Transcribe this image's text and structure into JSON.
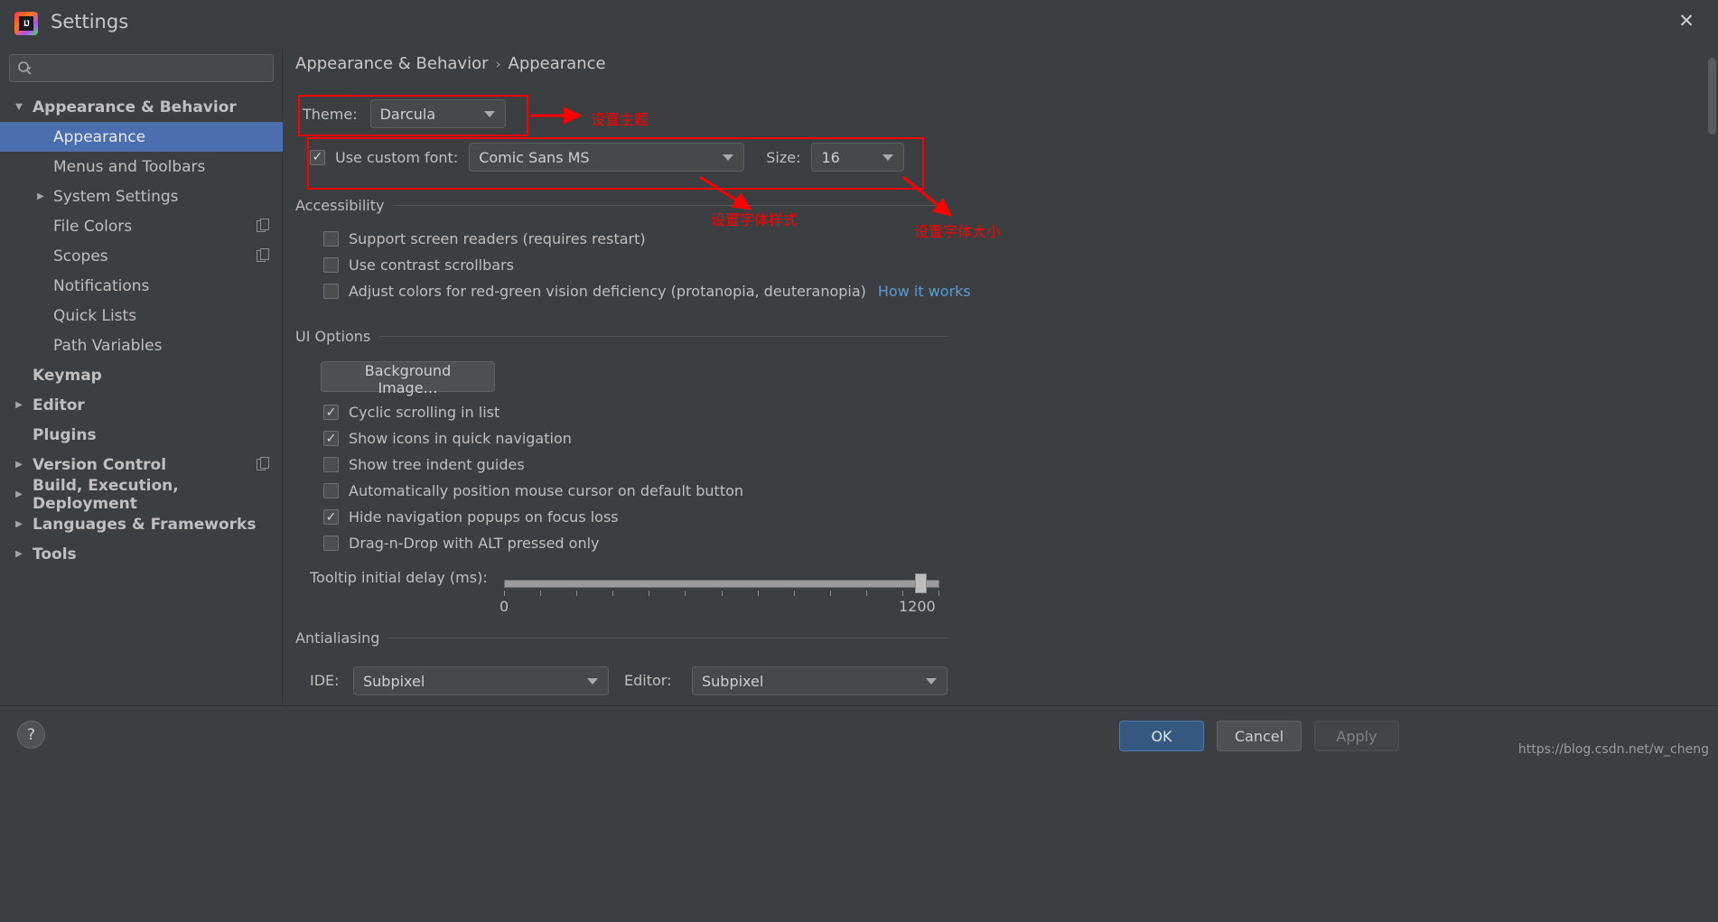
{
  "window": {
    "title": "Settings",
    "logo_text": "IJ",
    "close_icon": "✕"
  },
  "search": {
    "value": "",
    "placeholder": ""
  },
  "sidebar": {
    "items": [
      {
        "label": "Appearance & Behavior",
        "level": 0,
        "twisty": "down",
        "selected": false,
        "badge": false
      },
      {
        "label": "Appearance",
        "level": 1,
        "twisty": "none",
        "selected": true,
        "badge": false
      },
      {
        "label": "Menus and Toolbars",
        "level": 1,
        "twisty": "none",
        "selected": false,
        "badge": false
      },
      {
        "label": "System Settings",
        "level": 1,
        "twisty": "right",
        "selected": false,
        "badge": false
      },
      {
        "label": "File Colors",
        "level": 1,
        "twisty": "none",
        "selected": false,
        "badge": true
      },
      {
        "label": "Scopes",
        "level": 1,
        "twisty": "none",
        "selected": false,
        "badge": true
      },
      {
        "label": "Notifications",
        "level": 1,
        "twisty": "none",
        "selected": false,
        "badge": false
      },
      {
        "label": "Quick Lists",
        "level": 1,
        "twisty": "none",
        "selected": false,
        "badge": false
      },
      {
        "label": "Path Variables",
        "level": 1,
        "twisty": "none",
        "selected": false,
        "badge": false
      },
      {
        "label": "Keymap",
        "level": 0,
        "twisty": "none",
        "selected": false,
        "badge": false
      },
      {
        "label": "Editor",
        "level": 0,
        "twisty": "right",
        "selected": false,
        "badge": false
      },
      {
        "label": "Plugins",
        "level": 0,
        "twisty": "none",
        "selected": false,
        "badge": false
      },
      {
        "label": "Version Control",
        "level": 0,
        "twisty": "right",
        "selected": false,
        "badge": true
      },
      {
        "label": "Build, Execution, Deployment",
        "level": 0,
        "twisty": "right",
        "selected": false,
        "badge": false
      },
      {
        "label": "Languages & Frameworks",
        "level": 0,
        "twisty": "right",
        "selected": false,
        "badge": false
      },
      {
        "label": "Tools",
        "level": 0,
        "twisty": "right",
        "selected": false,
        "badge": false
      }
    ]
  },
  "main": {
    "breadcrumb": {
      "root": "Appearance & Behavior",
      "separator": "›",
      "leaf": "Appearance"
    },
    "theme": {
      "label": "Theme:",
      "value": "Darcula"
    },
    "font": {
      "checkbox_label": "Use custom font:",
      "checked": true,
      "family": "Comic Sans MS",
      "size_label": "Size:",
      "size_value": "16"
    },
    "accessibility": {
      "title": "Accessibility",
      "items": [
        {
          "label": "Support screen readers (requires restart)",
          "checked": false,
          "link": ""
        },
        {
          "label": "Use contrast scrollbars",
          "checked": false,
          "link": ""
        },
        {
          "label": "Adjust colors for red-green vision deficiency (protanopia, deuteranopia)",
          "checked": false,
          "link": "How it works"
        }
      ]
    },
    "ui_options": {
      "title": "UI Options",
      "background_image_button": "Background Image…",
      "items": [
        {
          "label": "Cyclic scrolling in list",
          "checked": true
        },
        {
          "label": "Show icons in quick navigation",
          "checked": true
        },
        {
          "label": "Show tree indent guides",
          "checked": false
        },
        {
          "label": "Automatically position mouse cursor on default button",
          "checked": false
        },
        {
          "label": "Hide navigation popups on focus loss",
          "checked": true
        },
        {
          "label": "Drag-n-Drop with ALT pressed only",
          "checked": false
        }
      ],
      "tooltip_delay": {
        "label": "Tooltip initial delay (ms):",
        "min": "0",
        "max": "1200",
        "value": "1200"
      }
    },
    "antialiasing": {
      "title": "Antialiasing",
      "ide_label": "IDE:",
      "ide_value": "Subpixel",
      "editor_label": "Editor:",
      "editor_value": "Subpixel"
    }
  },
  "annotations": {
    "color": "#ff0000",
    "theme_note": "设置主题",
    "font_style_note": "设置字体样式",
    "font_size_note": "设置字体大小"
  },
  "footer": {
    "help_icon": "?",
    "ok": "OK",
    "cancel": "Cancel",
    "apply": "Apply",
    "watermark": "https://blog.csdn.net/w_cheng"
  }
}
